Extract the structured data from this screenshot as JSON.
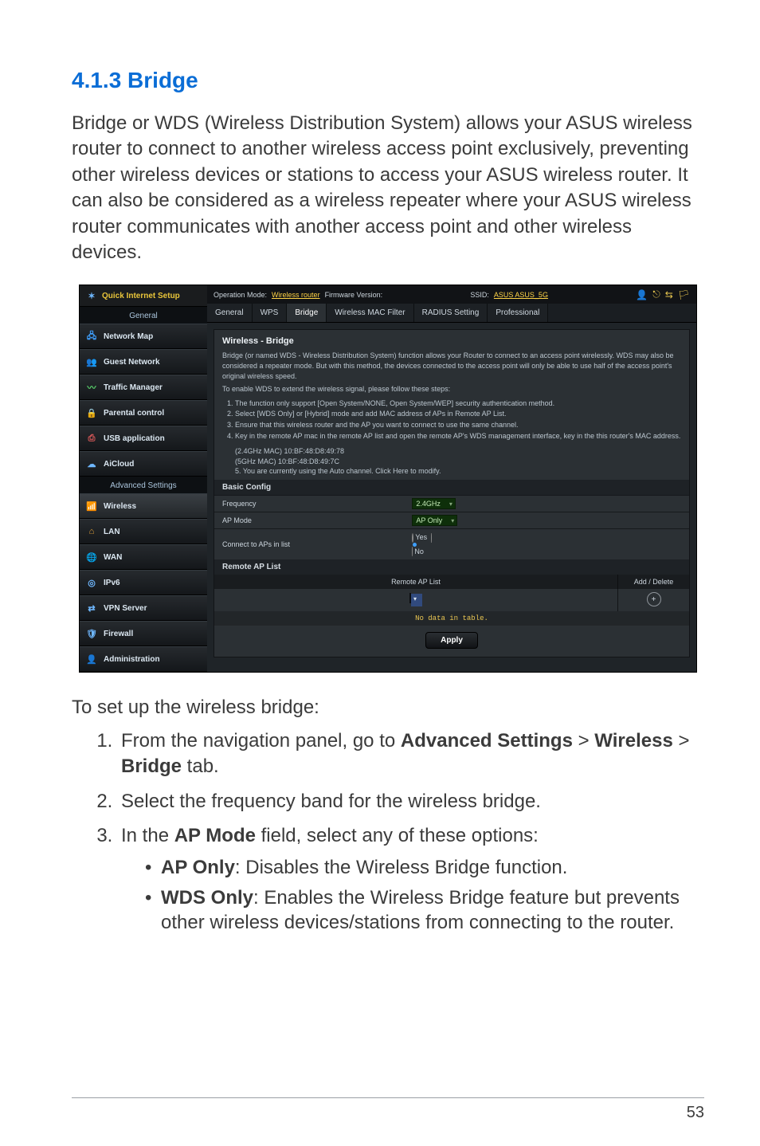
{
  "heading": "4.1.3 Bridge",
  "intro": "Bridge or WDS (Wireless Distribution System) allows your ASUS wireless router to connect to another wireless access point exclusively, preventing other wireless devices or stations to access your ASUS wireless router. It can also be considered as a wireless repeater where your ASUS wireless router communicates with another access point and other wireless devices.",
  "sidebar": {
    "quick": "Quick Internet Setup",
    "general_label": "General",
    "advanced_label": "Advanced Settings",
    "general_items": [
      {
        "label": "Network Map"
      },
      {
        "label": "Guest Network"
      },
      {
        "label": "Traffic Manager"
      },
      {
        "label": "Parental control"
      },
      {
        "label": "USB application"
      },
      {
        "label": "AiCloud"
      }
    ],
    "advanced_items": [
      {
        "label": "Wireless"
      },
      {
        "label": "LAN"
      },
      {
        "label": "WAN"
      },
      {
        "label": "IPv6"
      },
      {
        "label": "VPN Server"
      },
      {
        "label": "Firewall"
      },
      {
        "label": "Administration"
      }
    ]
  },
  "topbar": {
    "op_mode_label": "Operation Mode:",
    "op_mode_value": "Wireless router",
    "fw_label": "Firmware Version:",
    "ssid_label": "SSID:",
    "ssid_value": "ASUS ASUS_5G"
  },
  "tabs": [
    "General",
    "WPS",
    "Bridge",
    "Wireless MAC Filter",
    "RADIUS Setting",
    "Professional"
  ],
  "panel": {
    "title": "Wireless - Bridge",
    "p1": "Bridge (or named WDS - Wireless Distribution System) function allows your Router to connect to an access point wirelessly. WDS may also be considered a repeater mode. But with this method, the devices connected to the access point will only be able to use half of the access point's original wireless speed.",
    "p2": "To enable WDS to extend the wireless signal, please follow these steps:",
    "steps": [
      "The function only support [Open System/NONE, Open System/WEP] security authentication method.",
      "Select [WDS Only] or [Hybrid] mode and add MAC address of APs in Remote AP List.",
      "Ensure that this wireless router and the AP you want to connect to use the same channel.",
      "Key in the remote AP mac in the remote AP list and open the remote AP's WDS management interface, key in the this router's MAC address."
    ],
    "mac24": "(2.4GHz MAC) 10:BF:48:D8:49:78",
    "mac5": "(5GHz MAC) 10:BF:48:D8:49:7C",
    "step5_a": "You are currently using the Auto channel. Click ",
    "step5_link": "Here",
    "step5_b": " to modify.",
    "basic_config": "Basic Config",
    "rows": {
      "frequency_label": "Frequency",
      "frequency_value": "2.4GHz",
      "apmode_label": "AP Mode",
      "apmode_value": "AP Only",
      "connect_label": "Connect to APs in list",
      "yes": "Yes",
      "no": "No"
    },
    "remote_label": "Remote AP List",
    "remote_head": "Remote AP List",
    "add_delete": "Add / Delete",
    "nodata": "No data in table.",
    "apply": "Apply"
  },
  "instructions": {
    "lead": "To set up the wireless bridge:",
    "li1_a": "From the navigation panel, go to ",
    "li1_b1": "Advanced Settings",
    "li1_gt1": " > ",
    "li1_b2": "Wireless",
    "li1_gt2": " > ",
    "li1_b3": "Bridge",
    "li1_c": " tab.",
    "li2": "Select the frequency band for the wireless bridge.",
    "li3_a": "In the ",
    "li3_b": "AP Mode",
    "li3_c": " field, select any of these options:",
    "sub1_b": "AP Only",
    "sub1_t": ": Disables the Wireless Bridge function.",
    "sub2_b": "WDS Only",
    "sub2_t": ": Enables the Wireless Bridge feature but prevents other wireless devices/stations from connecting to the router."
  },
  "page_number": "53"
}
